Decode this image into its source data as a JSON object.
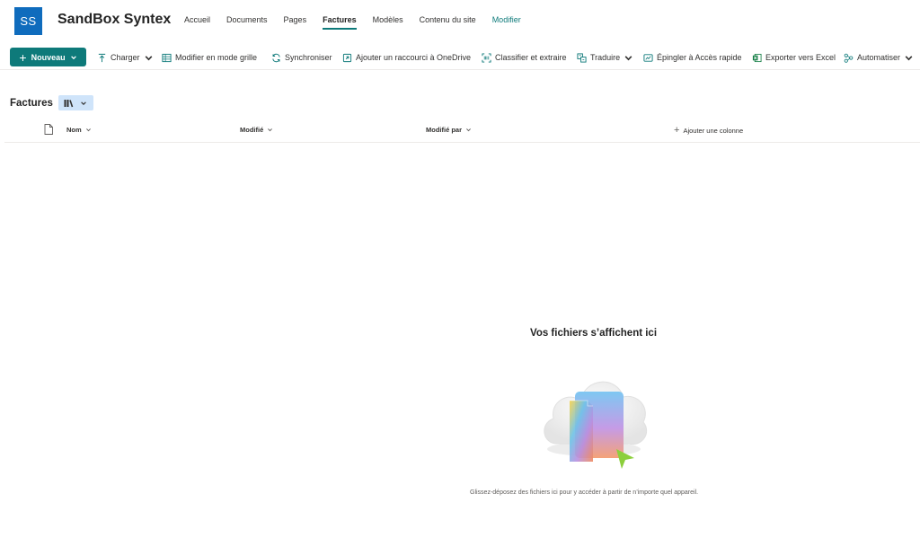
{
  "site": {
    "logo_initials": "SS",
    "title": "SandBox Syntex",
    "nav": [
      {
        "label": "Accueil"
      },
      {
        "label": "Documents"
      },
      {
        "label": "Pages"
      },
      {
        "label": "Factures"
      },
      {
        "label": "Modèles"
      },
      {
        "label": "Contenu du site"
      },
      {
        "label": "Modifier"
      }
    ],
    "active_nav": "Factures"
  },
  "command_bar": {
    "new_label": "Nouveau",
    "upload_label": "Charger",
    "grid_edit_label": "Modifier en mode grille",
    "sync_label": "Synchroniser",
    "onedrive_shortcut_label": "Ajouter un raccourci à OneDrive",
    "classify_label": "Classifier et extraire",
    "translate_label": "Traduire",
    "pin_label": "Épingler à Accès rapide",
    "export_label": "Exporter vers Excel",
    "automate_label": "Automatiser"
  },
  "library": {
    "title": "Factures",
    "columns": {
      "name": "Nom",
      "modified": "Modifié",
      "modified_by": "Modifié par",
      "add_column": "Ajouter une colonne"
    }
  },
  "empty_state": {
    "title": "Vos fichiers s’affichent ici",
    "hint": "Glissez-déposez des fichiers ici pour y accéder à partir de n’importe quel appareil."
  },
  "colors": {
    "accent": "#0e7a7a",
    "logo": "#0f6cbd"
  }
}
